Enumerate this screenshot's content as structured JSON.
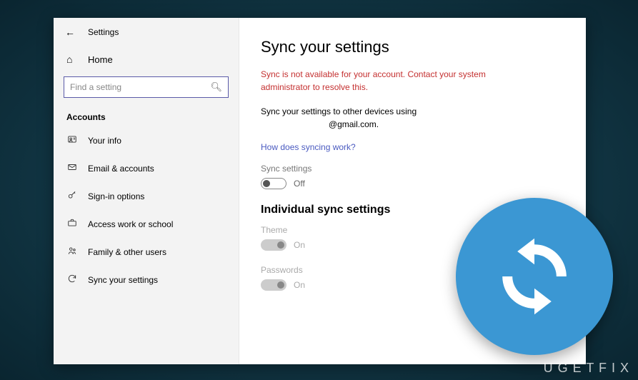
{
  "window": {
    "title": "Settings"
  },
  "sidebar": {
    "home": "Home",
    "search_placeholder": "Find a setting",
    "section": "Accounts",
    "items": [
      {
        "label": "Your info"
      },
      {
        "label": "Email & accounts"
      },
      {
        "label": "Sign-in options"
      },
      {
        "label": "Access work or school"
      },
      {
        "label": "Family & other users"
      },
      {
        "label": "Sync your settings"
      }
    ]
  },
  "main": {
    "title": "Sync your settings",
    "error": "Sync is not available for your account. Contact your system administrator to resolve this.",
    "desc_line1": "Sync your settings to other devices using",
    "desc_line2": "@gmail.com.",
    "link": "How does syncing work?",
    "sync_settings_label": "Sync settings",
    "sync_settings_state": "Off",
    "subheading": "Individual sync settings",
    "theme_label": "Theme",
    "theme_state": "On",
    "passwords_label": "Passwords",
    "passwords_state": "On"
  },
  "watermark": "UGETFIX"
}
